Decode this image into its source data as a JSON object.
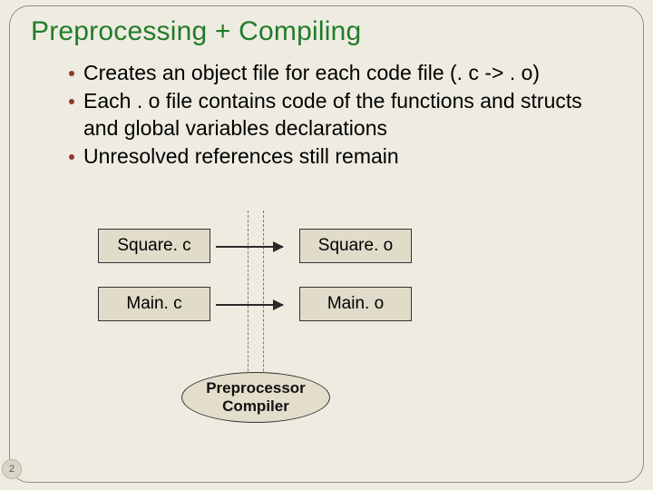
{
  "slide": {
    "title": "Preprocessing + Compiling",
    "bullets": [
      "Creates an object file for each code file  (. c -> . o)",
      "Each . o file contains code of the functions and structs and global variables declarations",
      "Unresolved references still remain"
    ],
    "boxes": {
      "src1": "Square. c",
      "out1": "Square. o",
      "src2": "Main. c",
      "out2": "Main. o"
    },
    "ellipse": {
      "line1": "Preprocessor",
      "line2": "Compiler"
    },
    "page_number": "2"
  }
}
